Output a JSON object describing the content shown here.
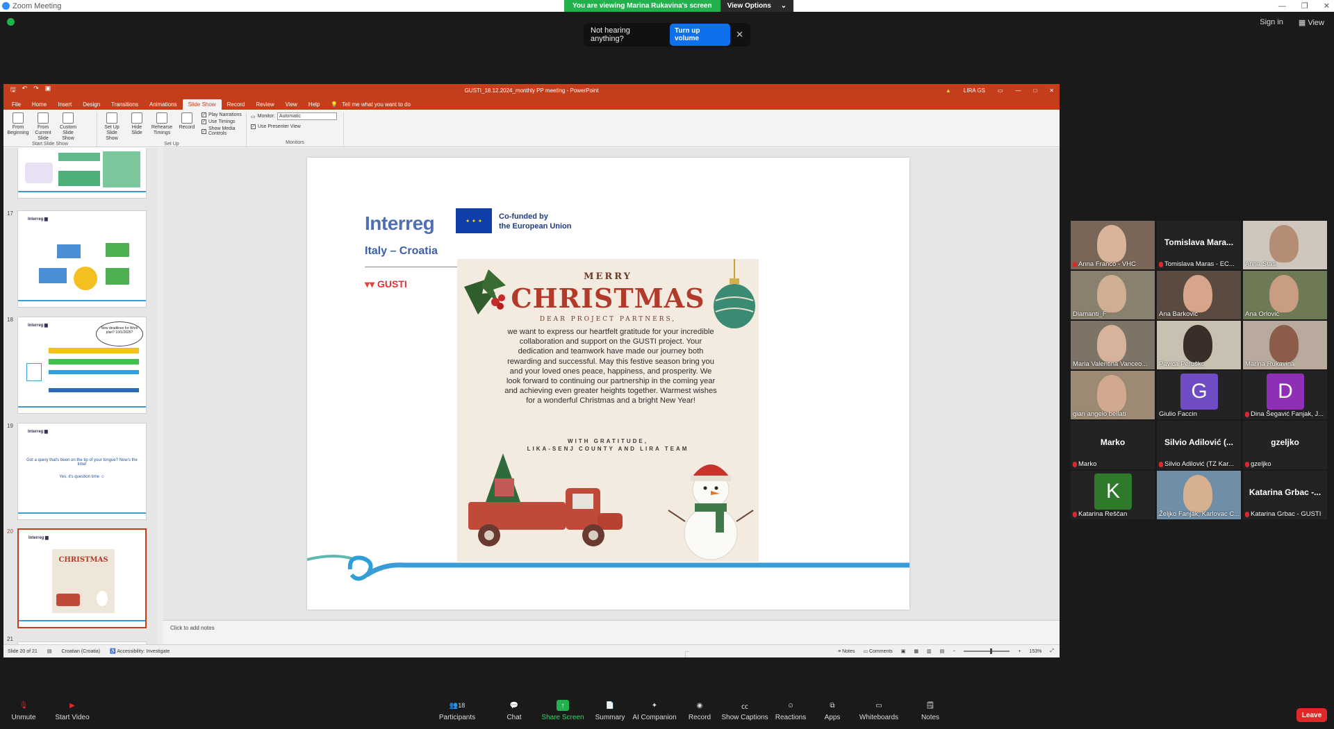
{
  "zoom": {
    "window_title": "Zoom Meeting",
    "viewing_banner": "You are viewing Marina Rukavina's screen",
    "view_options": "View Options",
    "sign_in": "Sign in",
    "view": "View",
    "toast_text": "Not hearing anything?",
    "toast_button": "Turn up volume",
    "participants_count": "18"
  },
  "ppt": {
    "doc_title": "GUSTI_18.12.2024_monthly PP meeting - PowerPoint",
    "user": "LIRA GS",
    "tabs": [
      "File",
      "Home",
      "Insert",
      "Design",
      "Transitions",
      "Animations",
      "Slide Show",
      "Record",
      "Review",
      "View",
      "Help"
    ],
    "tell_me": "Tell me what you want to do",
    "ribbon": {
      "from_beginning": "From Beginning",
      "from_current": "From Current Slide",
      "custom_show": "Custom Slide Show",
      "group_start": "Start Slide Show",
      "set_up_show": "Set Up Slide Show",
      "hide_slide": "Hide Slide",
      "rehearse": "Rehearse Timings",
      "record": "Record",
      "play_narrations": "Play Narrations",
      "use_timings": "Use Timings",
      "show_media": "Show Media Controls",
      "group_setup": "Set Up",
      "monitor_label": "Monitor:",
      "monitor_value": "Automatic",
      "use_presenter": "Use Presenter View",
      "group_monitors": "Monitors"
    },
    "thumb_numbers": [
      "17",
      "18",
      "19",
      "20",
      "21"
    ],
    "thumb19_text1": "Got a query that's been on the tip of your tongue? Now's the time!",
    "thumb19_text2": "Yes, it's question time ☺",
    "thumb18_bubble": "New deadlines for Work plan? 10/1/2025?",
    "notes_placeholder": "Click to add notes",
    "status_slide": "Slide 20 of 21",
    "status_lang": "Croatian (Croatia)",
    "status_access": "Accessibility: Investigate",
    "status_notes": "Notes",
    "status_comments": "Comments",
    "zoom_level": "153%"
  },
  "slide": {
    "interreg": "Interreg",
    "cofunded": "Co-funded by",
    "eu": "the European Union",
    "program": "Italy – Croatia",
    "gusti": "GUSTI",
    "merry": "MERRY",
    "christmas": "CHRISTMAS",
    "dear": "DEAR PROJECT PARTNERS,",
    "message": "we want to express our heartfelt gratitude for your incredible collaboration and support on the GUSTI project. Your dedication and teamwork have made our journey both rewarding and successful. May this festive season bring you and your loved ones peace, happiness, and prosperity. We look forward to continuing our partnership in the coming year and achieving even greater heights together. Warmest wishes for a wonderful Christmas and a bright New Year!",
    "gratitude1": "WITH GRATITUDE,",
    "gratitude2": "LIKA-SENJ COUNTY AND LIRA TEAM"
  },
  "participants": [
    {
      "name": "Anna Franco - VHC",
      "muted": true,
      "type": "video",
      "bg": "#7a6658",
      "face": "#d9b39a"
    },
    {
      "name": "Tomislava Maras - EC...",
      "muted": true,
      "type": "name",
      "display": "Tomislava Mara..."
    },
    {
      "name": "Anna Stasi",
      "muted": false,
      "type": "video",
      "bg": "#cfc7bd",
      "face": "#b58d74"
    },
    {
      "name": "Diamanti_F",
      "muted": false,
      "type": "video",
      "bg": "#8a8070",
      "face": "#cfae94"
    },
    {
      "name": "Ana Barković",
      "muted": false,
      "type": "video",
      "bg": "#5b4a40",
      "face": "#d6a58a"
    },
    {
      "name": "Ana Orlović",
      "muted": false,
      "type": "video",
      "bg": "#6d7a55",
      "face": "#c99d82",
      "active": true
    },
    {
      "name": "Maria Valentina Vanceo...",
      "muted": false,
      "type": "video",
      "bg": "#7d7366",
      "face": "#d8b39c"
    },
    {
      "name": "Pavica Peruško",
      "muted": false,
      "type": "video",
      "bg": "#c8c0b0",
      "face": "#3a2e28"
    },
    {
      "name": "Marina Rukavina",
      "muted": false,
      "type": "video",
      "bg": "#b8aa9c",
      "face": "#8c5c48"
    },
    {
      "name": "gian angelo bellati",
      "muted": false,
      "type": "video",
      "bg": "#9c8a75",
      "face": "#d2a98e"
    },
    {
      "name": "Giulio Faccin",
      "muted": false,
      "type": "letter",
      "letter": "G",
      "color": "#6f4cc4"
    },
    {
      "name": "Dina Šegavić Fanjak, J...",
      "muted": true,
      "type": "letter",
      "letter": "D",
      "color": "#8e2fb5"
    },
    {
      "name": "Marko",
      "muted": true,
      "type": "name",
      "display": "Marko"
    },
    {
      "name": "Silvio Adilović (TZ Kar...",
      "muted": true,
      "type": "name",
      "display": "Silvio Adilović (..."
    },
    {
      "name": "gzeljko",
      "muted": true,
      "type": "name",
      "display": "gzeljko"
    },
    {
      "name": "Katarina Reščan",
      "muted": true,
      "type": "letter",
      "letter": "K",
      "color": "#2f7a2a"
    },
    {
      "name": "Željko Fanjak, Karlovac C...",
      "muted": false,
      "type": "video",
      "bg": "#6f8fa8",
      "face": "#d7b08f"
    },
    {
      "name": "Katarina Grbac - GUSTI",
      "muted": true,
      "type": "name",
      "display": "Katarina Grbac -..."
    }
  ],
  "toolbar": {
    "unmute": "Unmute",
    "start_video": "Start Video",
    "participants": "Participants",
    "chat": "Chat",
    "share": "Share Screen",
    "summary": "Summary",
    "ai": "AI Companion",
    "record": "Record",
    "captions": "Show Captions",
    "reactions": "Reactions",
    "apps": "Apps",
    "whiteboards": "Whiteboards",
    "notes": "Notes",
    "leave": "Leave"
  },
  "colors": {
    "ppt_red": "#c43e1c",
    "zoom_green": "#23b14d",
    "zoom_blue": "#0e71eb",
    "leave_red": "#e02828"
  }
}
